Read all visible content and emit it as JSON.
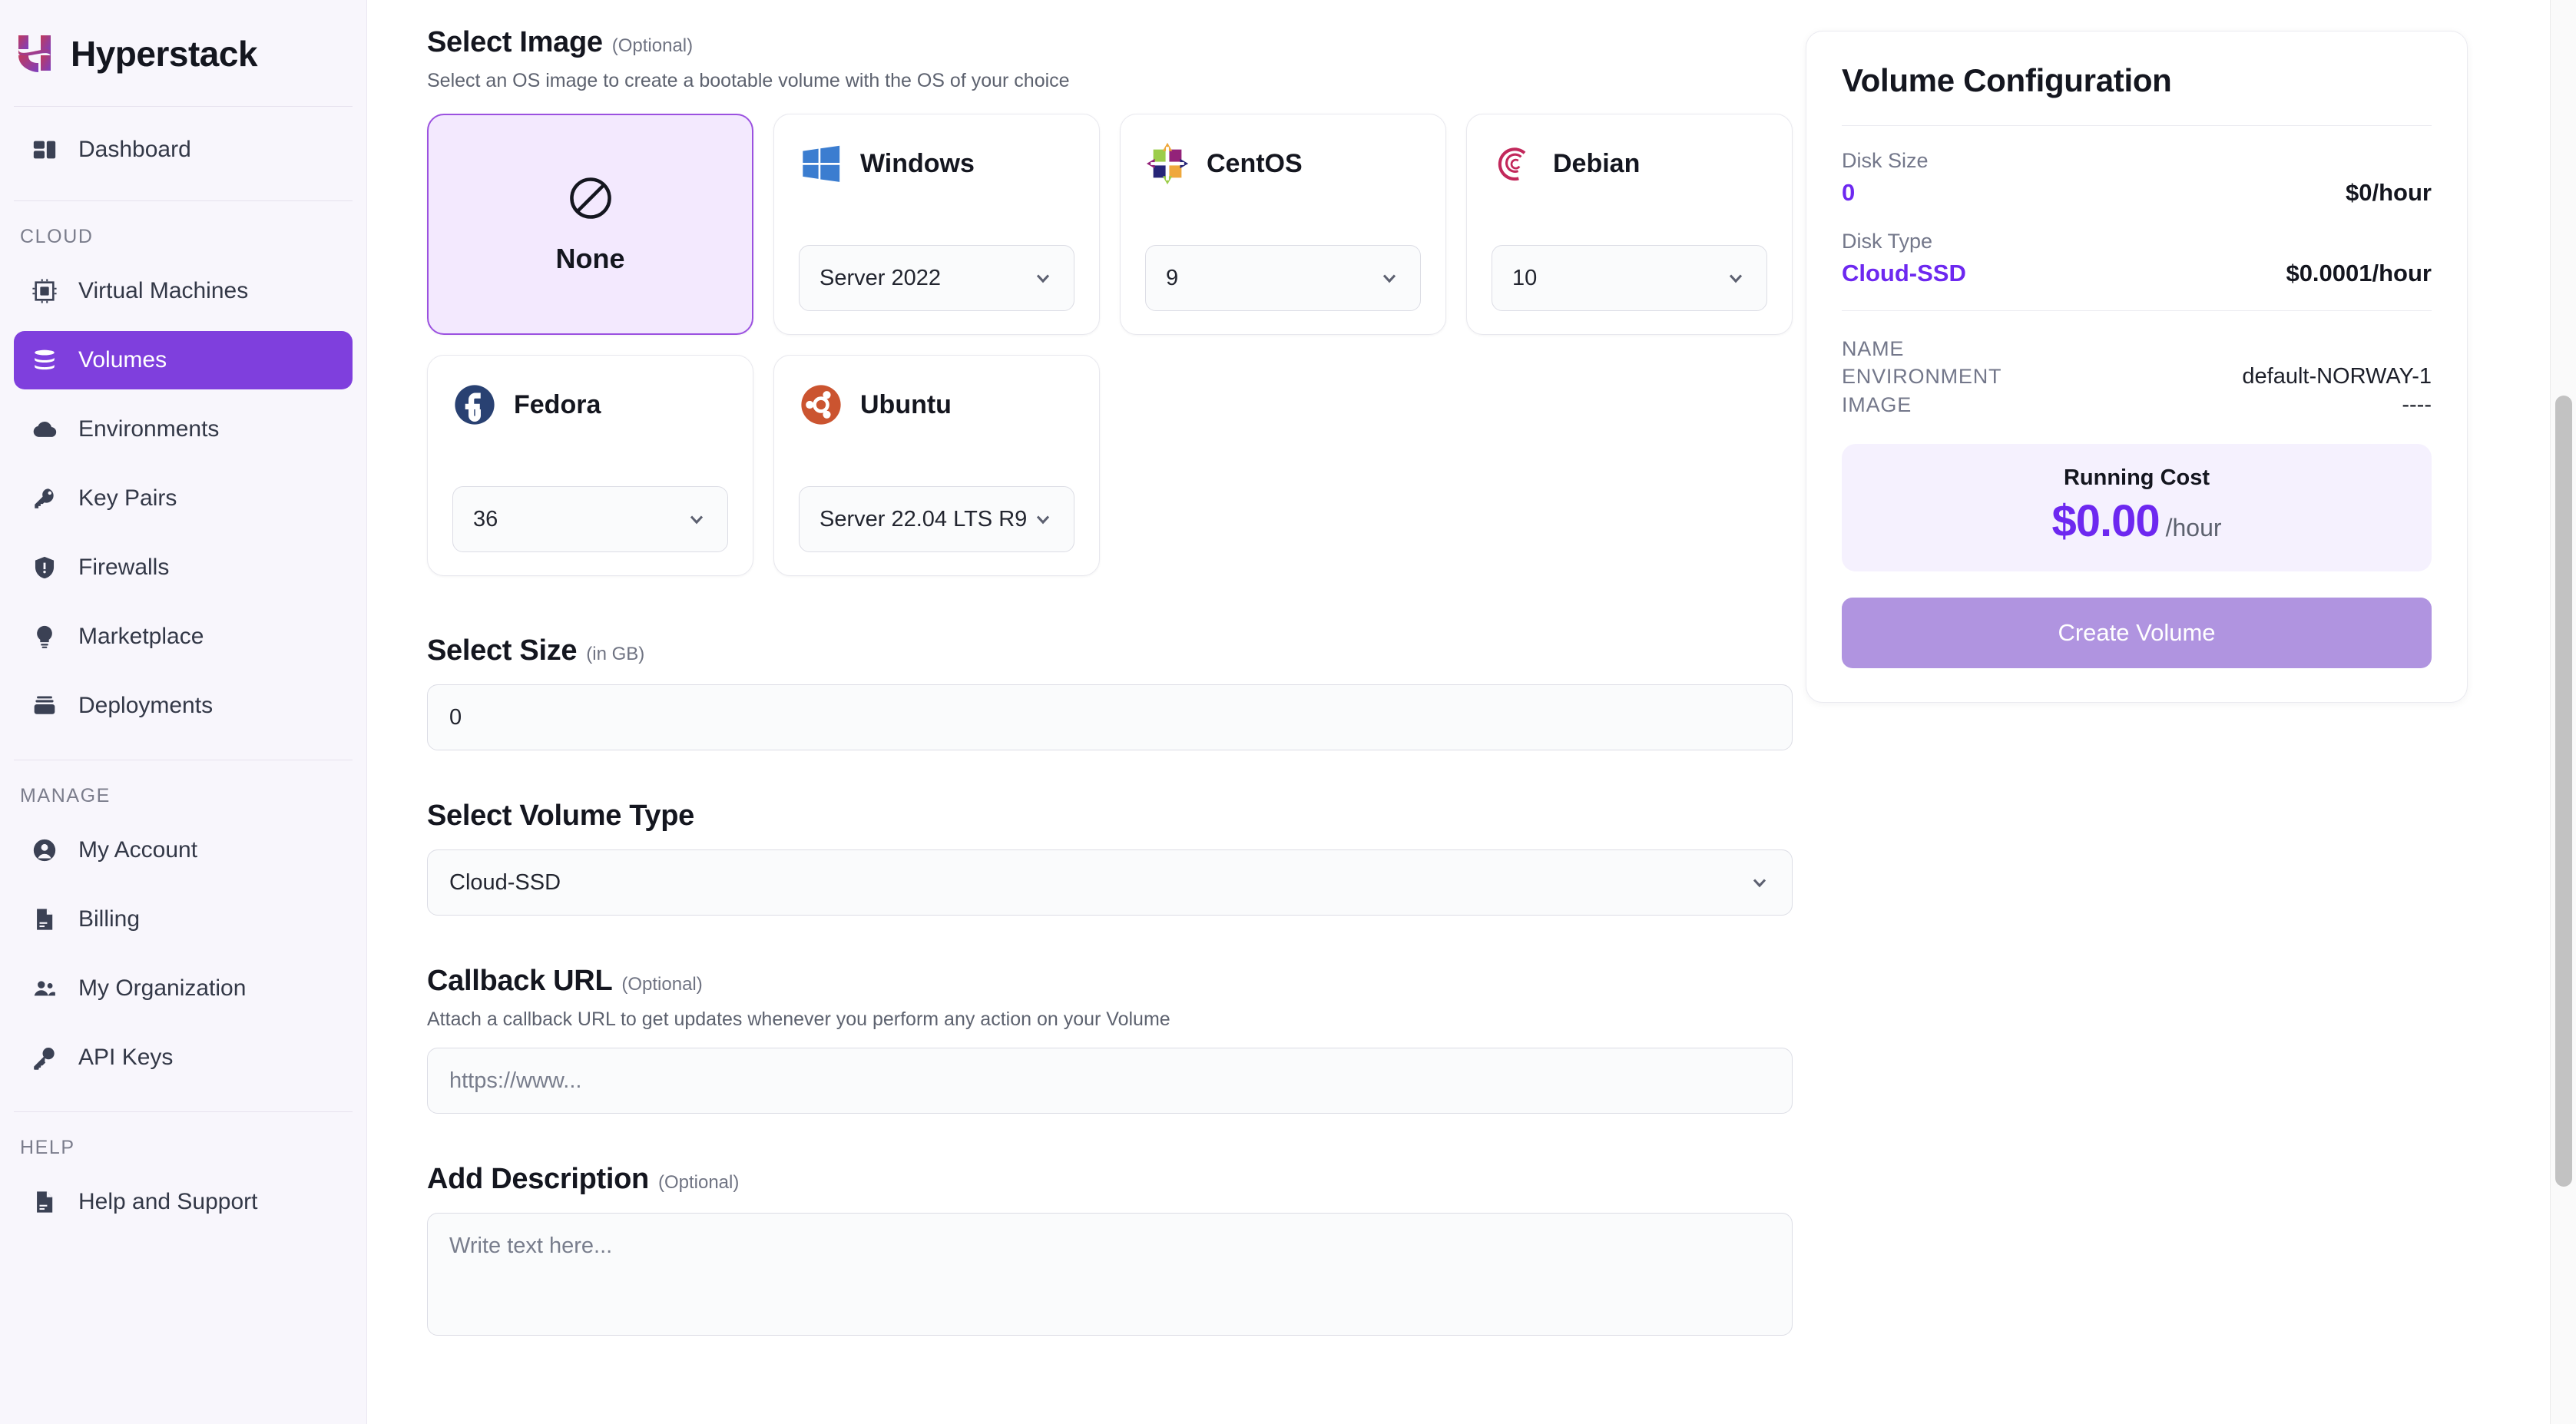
{
  "brand": {
    "name": "Hyperstack",
    "logo_icon": "hyperstack-logo"
  },
  "sidebar": {
    "primary": [
      {
        "label": "Dashboard",
        "icon": "dashboard-icon",
        "active": false
      }
    ],
    "groups": [
      {
        "label": "CLOUD",
        "items": [
          {
            "label": "Virtual Machines",
            "icon": "cpu-icon",
            "active": false
          },
          {
            "label": "Volumes",
            "icon": "server-stack-icon",
            "active": true
          },
          {
            "label": "Environments",
            "icon": "cloud-icon",
            "active": false
          },
          {
            "label": "Key Pairs",
            "icon": "key-icon",
            "active": false
          },
          {
            "label": "Firewalls",
            "icon": "shield-alert-icon",
            "active": false
          },
          {
            "label": "Marketplace",
            "icon": "lightbulb-icon",
            "active": false
          },
          {
            "label": "Deployments",
            "icon": "stack-icon",
            "active": false
          }
        ]
      },
      {
        "label": "MANAGE",
        "items": [
          {
            "label": "My Account",
            "icon": "user-circle-icon",
            "active": false
          },
          {
            "label": "Billing",
            "icon": "document-icon",
            "active": false
          },
          {
            "label": "My Organization",
            "icon": "users-group-icon",
            "active": false
          },
          {
            "label": "API Keys",
            "icon": "key-outline-icon",
            "active": false
          }
        ]
      },
      {
        "label": "HELP",
        "items": [
          {
            "label": "Help and Support",
            "icon": "document-icon",
            "active": false
          }
        ]
      }
    ]
  },
  "form": {
    "select_image": {
      "title": "Select Image",
      "optional": "(Optional)",
      "subtitle": "Select an OS image to create a bootable volume with the OS of your choice",
      "cards": [
        {
          "name": "None",
          "icon": "no-entry-icon",
          "selected": true,
          "version": null
        },
        {
          "name": "Windows",
          "icon": "windows-logo-icon",
          "selected": false,
          "version": "Server 2022"
        },
        {
          "name": "CentOS",
          "icon": "centos-logo-icon",
          "selected": false,
          "version": "9"
        },
        {
          "name": "Debian",
          "icon": "debian-logo-icon",
          "selected": false,
          "version": "10"
        },
        {
          "name": "Fedora",
          "icon": "fedora-logo-icon",
          "selected": false,
          "version": "36"
        },
        {
          "name": "Ubuntu",
          "icon": "ubuntu-logo-icon",
          "selected": false,
          "version": "Server 22.04 LTS R9"
        }
      ]
    },
    "select_size": {
      "title": "Select Size",
      "unit_note": "(in GB)",
      "value": "0"
    },
    "select_volume_type": {
      "title": "Select Volume Type",
      "value": "Cloud-SSD"
    },
    "callback_url": {
      "title": "Callback URL",
      "optional": "(Optional)",
      "subtitle": "Attach a callback URL to get updates whenever you perform any action on your Volume",
      "placeholder": "https://www...",
      "value": ""
    },
    "add_description": {
      "title": "Add Description",
      "optional": "(Optional)",
      "placeholder": "Write text here...",
      "value": ""
    }
  },
  "config_panel": {
    "title": "Volume Configuration",
    "disk_size": {
      "key": "Disk Size",
      "value": "0",
      "price": "$0/hour"
    },
    "disk_type": {
      "key": "Disk Type",
      "value": "Cloud-SSD",
      "price": "$0.0001/hour"
    },
    "meta": [
      {
        "key": "NAME",
        "value": ""
      },
      {
        "key": "ENVIRONMENT",
        "value": "default-NORWAY-1"
      },
      {
        "key": "IMAGE",
        "value": "----"
      }
    ],
    "running_cost": {
      "label": "Running Cost",
      "amount": "$0.00",
      "per": "/hour"
    },
    "create_button": "Create Volume"
  },
  "colors": {
    "accent_purple": "#7f3fdd",
    "value_purple": "#6d28f0",
    "selected_card_bg": "#f3e9fe",
    "selected_card_border": "#9b51e0",
    "button_disabled": "#b094e0",
    "cost_box_bg": "#f5f1fe",
    "sidebar_bg": "#f8f6fc"
  }
}
